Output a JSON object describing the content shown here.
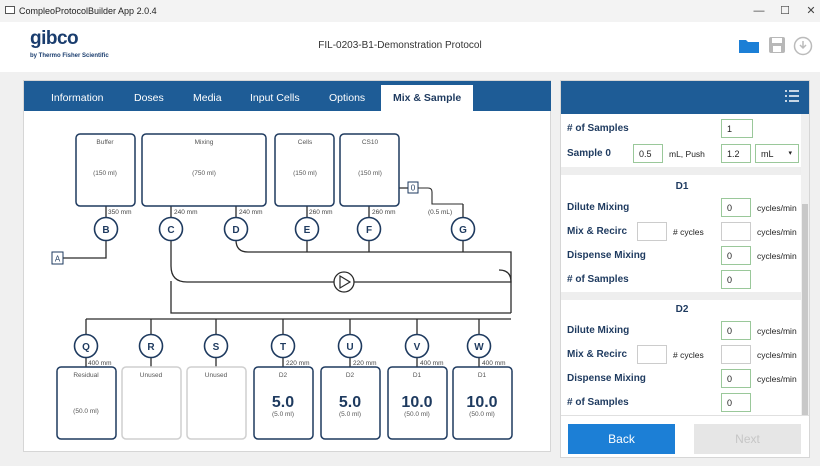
{
  "window": {
    "title": "CompleoProtocolBuilder App 2.0.4",
    "minimize": "—",
    "maximize": "☐",
    "close": "✕"
  },
  "header": {
    "logo": "gibco",
    "logo_sub": "by Thermo Fisher Scientific",
    "protocol_title": "FIL-0203-B1-Demonstration Protocol"
  },
  "tabs": [
    {
      "label": "Information"
    },
    {
      "label": "Doses"
    },
    {
      "label": "Media"
    },
    {
      "label": "Input Cells"
    },
    {
      "label": "Options"
    },
    {
      "label": "Mix & Sample"
    }
  ],
  "diagram": {
    "top_bags": [
      {
        "name": "Buffer",
        "volume": "(150 ml)"
      },
      {
        "name": "Mixing",
        "volume": "(750 ml)"
      },
      {
        "name": "Cells",
        "volume": "(150 ml)"
      },
      {
        "name": "CS10",
        "volume": "(150 ml)"
      }
    ],
    "top_ports": [
      "B",
      "C",
      "D",
      "E",
      "F",
      "G"
    ],
    "top_lengths": [
      "350 mm",
      "240 mm",
      "240 mm",
      "260 mm",
      "260 mm"
    ],
    "tag_a": "A",
    "tag_0": "0",
    "g_volume": "(0.5 mL)",
    "bottom_ports": [
      "Q",
      "R",
      "S",
      "T",
      "U",
      "V",
      "W"
    ],
    "bottom_lengths": [
      "400 mm",
      "220 mm",
      "220 mm",
      "400 mm",
      "400 mm"
    ],
    "bottom_bags": [
      {
        "name": "Residual",
        "value": "",
        "volume": "(50.0 ml)"
      },
      {
        "name": "Unused",
        "value": "",
        "volume": ""
      },
      {
        "name": "Unused",
        "value": "",
        "volume": ""
      },
      {
        "name": "D2",
        "value": "5.0",
        "volume": "(5.0 ml)"
      },
      {
        "name": "D2",
        "value": "5.0",
        "volume": "(5.0 ml)"
      },
      {
        "name": "D1",
        "value": "10.0",
        "volume": "(50.0 ml)"
      },
      {
        "name": "D1",
        "value": "10.0",
        "volume": "(50.0 ml)"
      }
    ]
  },
  "side_panel": {
    "samples_label": "# of Samples",
    "samples_value": "1",
    "sample0_label": "Sample 0",
    "sample0_value": "0.5",
    "sample0_unit": "mL, Push",
    "sample0_push": "1.2",
    "sample0_select": "mL",
    "d1_title": "D1",
    "d2_title": "D2",
    "dilute_label": "Dilute Mixing",
    "mixrecirc_label": "Mix & Recirc",
    "dispense_label": "Dispense Mixing",
    "nsamples_label": "# of Samples",
    "cycles_min": "cycles/min",
    "cycles": "# cycles",
    "d1": {
      "dilute": "0",
      "mix_cycles": "",
      "mix_rate": "",
      "dispense": "0",
      "samples": "0"
    },
    "d2": {
      "dilute": "0",
      "mix_cycles": "",
      "mix_rate": "",
      "dispense": "0",
      "samples": "0"
    }
  },
  "buttons": {
    "back": "Back",
    "next": "Next"
  },
  "colors": {
    "navy": "#1e5c96",
    "accent": "#1c7fd6",
    "bag_border": "#1e3a5f"
  }
}
